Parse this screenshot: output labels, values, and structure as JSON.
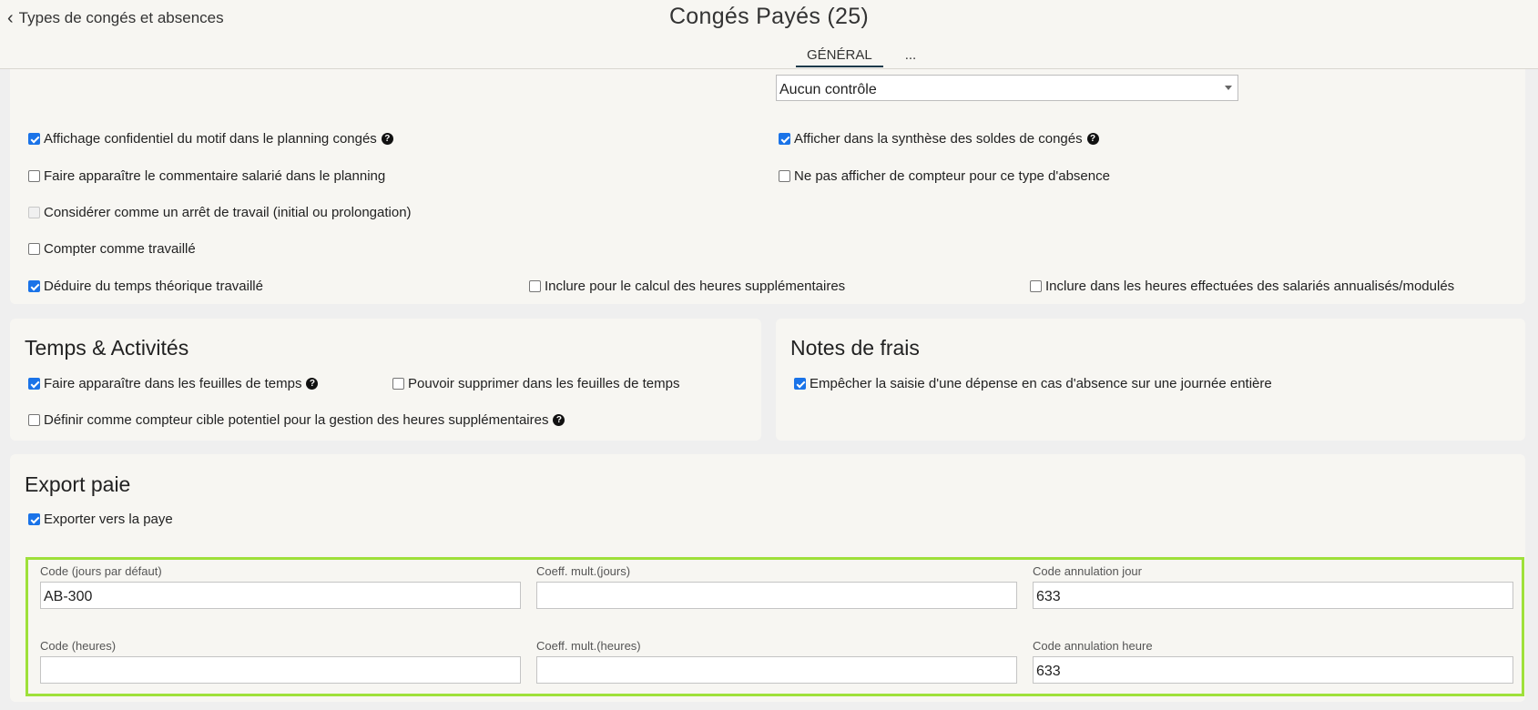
{
  "header": {
    "back_label": "Types de congés et absences",
    "title": "Congés Payés (25)",
    "tabs": [
      {
        "label": "GÉNÉRAL",
        "active": true
      },
      {
        "label": "..."
      }
    ]
  },
  "general": {
    "select_value": "Aucun contrôle",
    "options": [
      {
        "label": "Affichage confidentiel du motif dans le planning congés",
        "checked": true,
        "help": true
      },
      {
        "label": "Afficher dans la synthèse des soldes de congés",
        "checked": true,
        "help": true
      },
      {
        "label": "Faire apparaître le commentaire salarié dans le planning",
        "checked": false
      },
      {
        "label": "Ne pas afficher de compteur pour ce type d'absence",
        "checked": false
      },
      {
        "label": "Considérer comme un arrêt de travail (initial ou prolongation)",
        "checked": false,
        "disabled": true
      },
      {
        "label": "Compter comme travaillé",
        "checked": false
      },
      {
        "label": "Déduire du temps théorique travaillé",
        "checked": true
      },
      {
        "label": "Inclure pour le calcul des heures supplémentaires",
        "checked": false
      },
      {
        "label": "Inclure dans les heures effectuées des salariés annualisés/modulés",
        "checked": false
      }
    ]
  },
  "temps": {
    "title": "Temps & Activités",
    "options": [
      {
        "label": "Faire apparaître dans les feuilles de temps",
        "checked": true,
        "help": true
      },
      {
        "label": "Pouvoir supprimer dans les feuilles de temps",
        "checked": false
      },
      {
        "label": "Définir comme compteur cible potentiel pour la gestion des heures supplémentaires",
        "checked": false,
        "help": true
      }
    ]
  },
  "frais": {
    "title": "Notes de frais",
    "options": [
      {
        "label": "Empêcher la saisie d'une dépense en cas d'absence sur une journée entière",
        "checked": true
      }
    ]
  },
  "export": {
    "title": "Export paie",
    "export_option": {
      "label": "Exporter vers la paye",
      "checked": true
    },
    "fields": [
      {
        "label": "Code (jours par défaut)",
        "value": "AB-300"
      },
      {
        "label": "Coeff. mult.(jours)",
        "value": ""
      },
      {
        "label": "Code annulation jour",
        "value": "633"
      },
      {
        "label": "Code (heures)",
        "value": ""
      },
      {
        "label": "Coeff. mult.(heures)",
        "value": ""
      },
      {
        "label": "Code annulation heure",
        "value": "633"
      }
    ]
  },
  "colors": {
    "accent_checkbox": "#1a73e8",
    "highlight_border": "#9ee03a",
    "tab_underline": "#1c3a4a"
  }
}
